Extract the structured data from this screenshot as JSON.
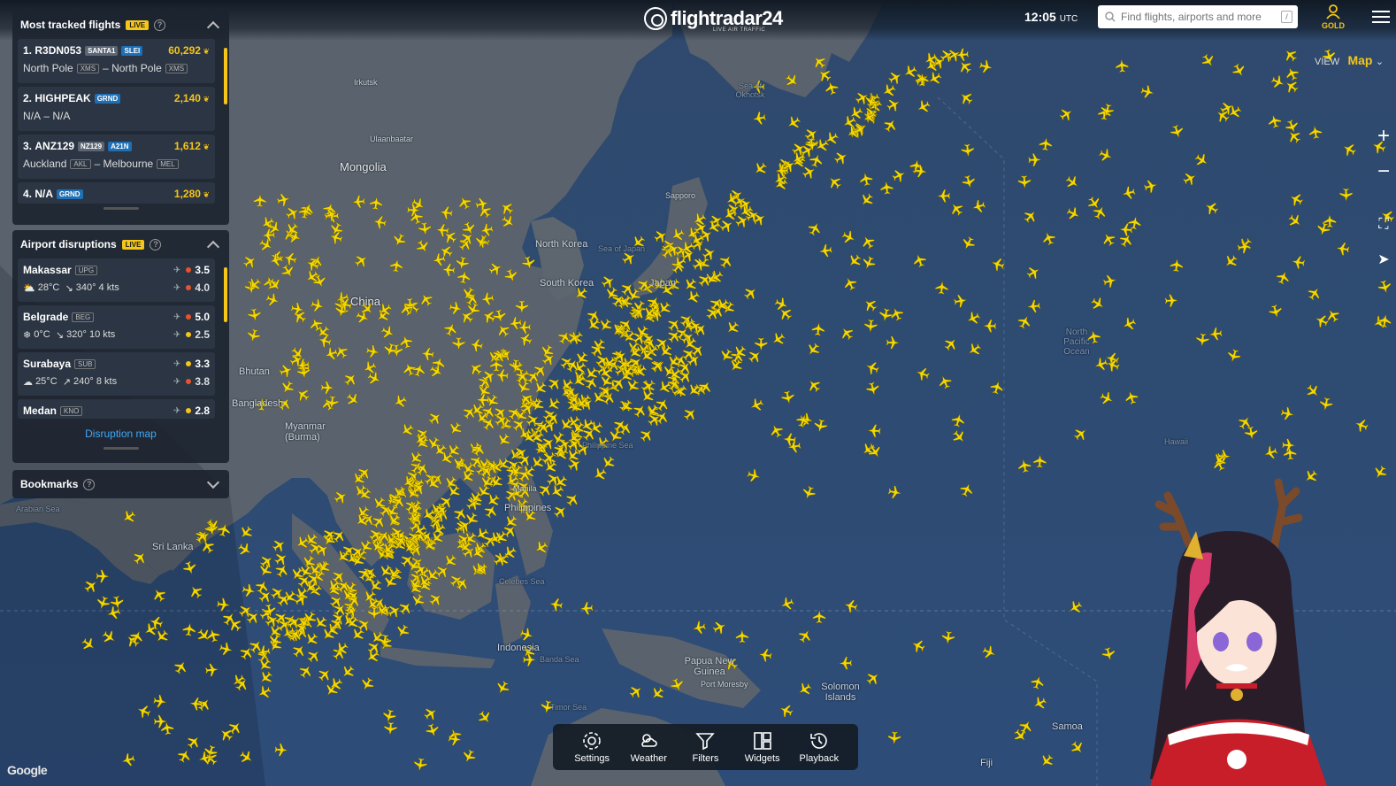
{
  "header": {
    "logo_text": "flightradar24",
    "logo_sub": "LIVE AIR TRAFFIC",
    "clock_time": "12:05",
    "clock_zone": "UTC",
    "search_placeholder": "Find flights, airports and more",
    "search_shortcut": "/",
    "account_label": "GOLD",
    "view_label": "VIEW",
    "view_value": "Map"
  },
  "most_tracked": {
    "title": "Most tracked flights",
    "live": "LIVE",
    "help": "?",
    "flights": [
      {
        "rank": "1.",
        "callsign": "R3DN053",
        "tags": [
          "SANTA1",
          "SLEI"
        ],
        "count": "60,292",
        "origin": "North Pole",
        "origin_code": "XMS",
        "dest": "North Pole",
        "dest_code": "XMS"
      },
      {
        "rank": "2.",
        "callsign": "HIGHPEAK",
        "tags": [
          "GRND"
        ],
        "count": "2,140",
        "origin": "N/A",
        "origin_code": "",
        "dest": "N/A",
        "dest_code": ""
      },
      {
        "rank": "3.",
        "callsign": "ANZ129",
        "tags": [
          "NZ129",
          "A21N"
        ],
        "count": "1,612",
        "origin": "Auckland",
        "origin_code": "AKL",
        "dest": "Melbourne",
        "dest_code": "MEL"
      },
      {
        "rank": "4.",
        "callsign": "N/A",
        "tags": [
          "GRND"
        ],
        "count": "1,280"
      }
    ]
  },
  "disruptions": {
    "title": "Airport disruptions",
    "live": "LIVE",
    "help": "?",
    "airports": [
      {
        "name": "Makassar",
        "code": "UPG",
        "arr": "3.5",
        "dep": "4.0",
        "arr_color": "#e8522d",
        "dep_color": "#e8522d",
        "temp": "28°C",
        "wind": "340° 4 kts"
      },
      {
        "name": "Belgrade",
        "code": "BEG",
        "arr": "5.0",
        "dep": "2.5",
        "arr_color": "#e8522d",
        "dep_color": "#f5c518",
        "temp": "0°C",
        "wind": "320° 10 kts"
      },
      {
        "name": "Surabaya",
        "code": "SUB",
        "arr": "3.3",
        "dep": "3.8",
        "arr_color": "#f5c518",
        "dep_color": "#e8522d",
        "temp": "25°C",
        "wind": "240° 8 kts"
      },
      {
        "name": "Medan",
        "code": "KNO",
        "arr": "2.8",
        "arr_color": "#f5c518"
      }
    ],
    "link": "Disruption map"
  },
  "bookmarks": {
    "title": "Bookmarks",
    "help": "?"
  },
  "toolbar": {
    "settings": "Settings",
    "weather": "Weather",
    "filters": "Filters",
    "widgets": "Widgets",
    "playback": "Playback"
  },
  "map_labels": {
    "mongolia": "Mongolia",
    "china": "China",
    "north_korea": "North Korea",
    "south_korea": "South Korea",
    "japan": "Japan",
    "bhutan": "Bhutan",
    "myanmar": "Myanmar (Burma)",
    "sri_lanka": "Sri Lanka",
    "indonesia": "Indonesia",
    "png": "Papua New Guinea",
    "solomon": "Solomon Islands",
    "samoa": "Samoa",
    "fiji": "Fiji",
    "irkutsk": "Irkutsk",
    "ulaanbaatar": "Ulaanbaatar",
    "sapporo": "Sapporo",
    "port_moresby": "Port Moresby",
    "manila": "Manila",
    "philippines": "Philippines",
    "bangladesh": "Bangladesh",
    "npo": "North Pacific Ocean",
    "arabian_sea": "Arabian Sea",
    "philippine_sea": "Philippine Sea",
    "sea_of_japan": "Sea of Japan",
    "sea_of_okhotsk": "Sea of Okhotsk",
    "banda_sea": "Banda Sea",
    "timor_sea": "Timor Sea",
    "celebes_sea": "Celebes Sea",
    "hawaii": "Hawaii",
    "google": "Google"
  },
  "colors": {
    "accent": "#f5c518",
    "ocean": "#2b4a74",
    "land": "#56606b",
    "aircraft": "#f5d800",
    "link": "#3fa9f5"
  }
}
